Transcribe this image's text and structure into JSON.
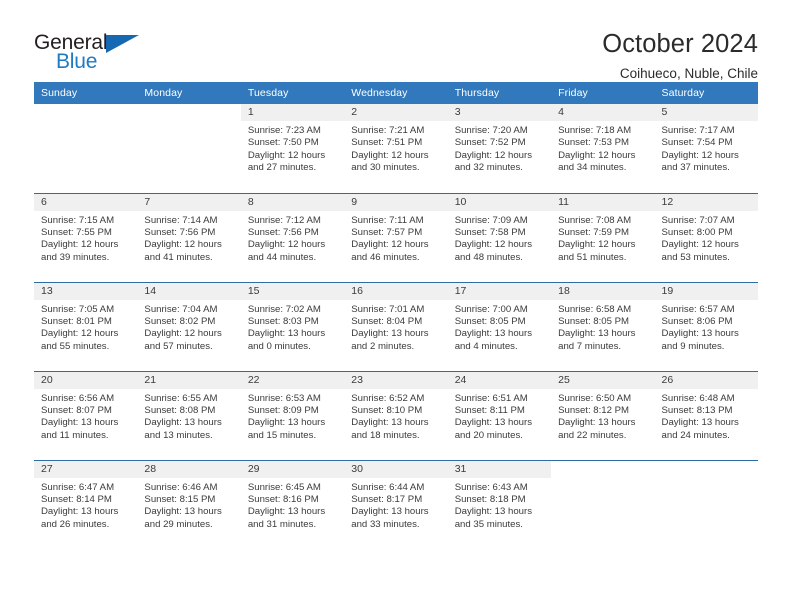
{
  "logo": {
    "text_primary": "General",
    "text_secondary": "Blue",
    "triangle_color": "#1668b3"
  },
  "header": {
    "title": "October 2024",
    "subtitle": "Coihueco, Nuble, Chile"
  },
  "theme": {
    "header_blue": "#3179bc",
    "row_divider_blue": "#2e6da4",
    "daynum_band": "#f0f0f0",
    "text": "#3b3b3b"
  },
  "calendar": {
    "weekday_headers": [
      "Sunday",
      "Monday",
      "Tuesday",
      "Wednesday",
      "Thursday",
      "Friday",
      "Saturday"
    ],
    "labels": {
      "sunrise": "Sunrise:",
      "sunset": "Sunset:",
      "daylight": "Daylight:"
    },
    "weeks": [
      [
        {
          "day": "",
          "blank": true,
          "sunrise": "",
          "sunset": "",
          "daylight_1": "",
          "daylight_2": ""
        },
        {
          "day": "",
          "blank": true,
          "sunrise": "",
          "sunset": "",
          "daylight_1": "",
          "daylight_2": ""
        },
        {
          "day": "1",
          "sunrise": "Sunrise: 7:23 AM",
          "sunset": "Sunset: 7:50 PM",
          "daylight_1": "Daylight: 12 hours",
          "daylight_2": "and 27 minutes."
        },
        {
          "day": "2",
          "sunrise": "Sunrise: 7:21 AM",
          "sunset": "Sunset: 7:51 PM",
          "daylight_1": "Daylight: 12 hours",
          "daylight_2": "and 30 minutes."
        },
        {
          "day": "3",
          "sunrise": "Sunrise: 7:20 AM",
          "sunset": "Sunset: 7:52 PM",
          "daylight_1": "Daylight: 12 hours",
          "daylight_2": "and 32 minutes."
        },
        {
          "day": "4",
          "sunrise": "Sunrise: 7:18 AM",
          "sunset": "Sunset: 7:53 PM",
          "daylight_1": "Daylight: 12 hours",
          "daylight_2": "and 34 minutes."
        },
        {
          "day": "5",
          "sunrise": "Sunrise: 7:17 AM",
          "sunset": "Sunset: 7:54 PM",
          "daylight_1": "Daylight: 12 hours",
          "daylight_2": "and 37 minutes."
        }
      ],
      [
        {
          "day": "6",
          "sunrise": "Sunrise: 7:15 AM",
          "sunset": "Sunset: 7:55 PM",
          "daylight_1": "Daylight: 12 hours",
          "daylight_2": "and 39 minutes."
        },
        {
          "day": "7",
          "sunrise": "Sunrise: 7:14 AM",
          "sunset": "Sunset: 7:56 PM",
          "daylight_1": "Daylight: 12 hours",
          "daylight_2": "and 41 minutes."
        },
        {
          "day": "8",
          "sunrise": "Sunrise: 7:12 AM",
          "sunset": "Sunset: 7:56 PM",
          "daylight_1": "Daylight: 12 hours",
          "daylight_2": "and 44 minutes."
        },
        {
          "day": "9",
          "sunrise": "Sunrise: 7:11 AM",
          "sunset": "Sunset: 7:57 PM",
          "daylight_1": "Daylight: 12 hours",
          "daylight_2": "and 46 minutes."
        },
        {
          "day": "10",
          "sunrise": "Sunrise: 7:09 AM",
          "sunset": "Sunset: 7:58 PM",
          "daylight_1": "Daylight: 12 hours",
          "daylight_2": "and 48 minutes."
        },
        {
          "day": "11",
          "sunrise": "Sunrise: 7:08 AM",
          "sunset": "Sunset: 7:59 PM",
          "daylight_1": "Daylight: 12 hours",
          "daylight_2": "and 51 minutes."
        },
        {
          "day": "12",
          "sunrise": "Sunrise: 7:07 AM",
          "sunset": "Sunset: 8:00 PM",
          "daylight_1": "Daylight: 12 hours",
          "daylight_2": "and 53 minutes."
        }
      ],
      [
        {
          "day": "13",
          "sunrise": "Sunrise: 7:05 AM",
          "sunset": "Sunset: 8:01 PM",
          "daylight_1": "Daylight: 12 hours",
          "daylight_2": "and 55 minutes."
        },
        {
          "day": "14",
          "sunrise": "Sunrise: 7:04 AM",
          "sunset": "Sunset: 8:02 PM",
          "daylight_1": "Daylight: 12 hours",
          "daylight_2": "and 57 minutes."
        },
        {
          "day": "15",
          "sunrise": "Sunrise: 7:02 AM",
          "sunset": "Sunset: 8:03 PM",
          "daylight_1": "Daylight: 13 hours",
          "daylight_2": "and 0 minutes."
        },
        {
          "day": "16",
          "sunrise": "Sunrise: 7:01 AM",
          "sunset": "Sunset: 8:04 PM",
          "daylight_1": "Daylight: 13 hours",
          "daylight_2": "and 2 minutes."
        },
        {
          "day": "17",
          "sunrise": "Sunrise: 7:00 AM",
          "sunset": "Sunset: 8:05 PM",
          "daylight_1": "Daylight: 13 hours",
          "daylight_2": "and 4 minutes."
        },
        {
          "day": "18",
          "sunrise": "Sunrise: 6:58 AM",
          "sunset": "Sunset: 8:05 PM",
          "daylight_1": "Daylight: 13 hours",
          "daylight_2": "and 7 minutes."
        },
        {
          "day": "19",
          "sunrise": "Sunrise: 6:57 AM",
          "sunset": "Sunset: 8:06 PM",
          "daylight_1": "Daylight: 13 hours",
          "daylight_2": "and 9 minutes."
        }
      ],
      [
        {
          "day": "20",
          "sunrise": "Sunrise: 6:56 AM",
          "sunset": "Sunset: 8:07 PM",
          "daylight_1": "Daylight: 13 hours",
          "daylight_2": "and 11 minutes."
        },
        {
          "day": "21",
          "sunrise": "Sunrise: 6:55 AM",
          "sunset": "Sunset: 8:08 PM",
          "daylight_1": "Daylight: 13 hours",
          "daylight_2": "and 13 minutes."
        },
        {
          "day": "22",
          "sunrise": "Sunrise: 6:53 AM",
          "sunset": "Sunset: 8:09 PM",
          "daylight_1": "Daylight: 13 hours",
          "daylight_2": "and 15 minutes."
        },
        {
          "day": "23",
          "sunrise": "Sunrise: 6:52 AM",
          "sunset": "Sunset: 8:10 PM",
          "daylight_1": "Daylight: 13 hours",
          "daylight_2": "and 18 minutes."
        },
        {
          "day": "24",
          "sunrise": "Sunrise: 6:51 AM",
          "sunset": "Sunset: 8:11 PM",
          "daylight_1": "Daylight: 13 hours",
          "daylight_2": "and 20 minutes."
        },
        {
          "day": "25",
          "sunrise": "Sunrise: 6:50 AM",
          "sunset": "Sunset: 8:12 PM",
          "daylight_1": "Daylight: 13 hours",
          "daylight_2": "and 22 minutes."
        },
        {
          "day": "26",
          "sunrise": "Sunrise: 6:48 AM",
          "sunset": "Sunset: 8:13 PM",
          "daylight_1": "Daylight: 13 hours",
          "daylight_2": "and 24 minutes."
        }
      ],
      [
        {
          "day": "27",
          "sunrise": "Sunrise: 6:47 AM",
          "sunset": "Sunset: 8:14 PM",
          "daylight_1": "Daylight: 13 hours",
          "daylight_2": "and 26 minutes."
        },
        {
          "day": "28",
          "sunrise": "Sunrise: 6:46 AM",
          "sunset": "Sunset: 8:15 PM",
          "daylight_1": "Daylight: 13 hours",
          "daylight_2": "and 29 minutes."
        },
        {
          "day": "29",
          "sunrise": "Sunrise: 6:45 AM",
          "sunset": "Sunset: 8:16 PM",
          "daylight_1": "Daylight: 13 hours",
          "daylight_2": "and 31 minutes."
        },
        {
          "day": "30",
          "sunrise": "Sunrise: 6:44 AM",
          "sunset": "Sunset: 8:17 PM",
          "daylight_1": "Daylight: 13 hours",
          "daylight_2": "and 33 minutes."
        },
        {
          "day": "31",
          "sunrise": "Sunrise: 6:43 AM",
          "sunset": "Sunset: 8:18 PM",
          "daylight_1": "Daylight: 13 hours",
          "daylight_2": "and 35 minutes."
        },
        {
          "day": "",
          "blank": true,
          "sunrise": "",
          "sunset": "",
          "daylight_1": "",
          "daylight_2": ""
        },
        {
          "day": "",
          "blank": true,
          "sunrise": "",
          "sunset": "",
          "daylight_1": "",
          "daylight_2": ""
        }
      ]
    ]
  }
}
